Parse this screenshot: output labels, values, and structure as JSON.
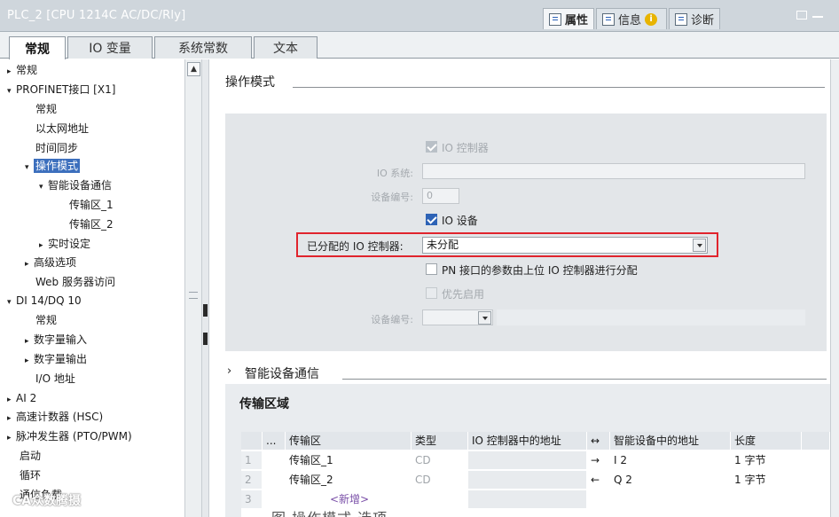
{
  "window": {
    "title": "PLC_2 [CPU 1214C AC/DC/Rly]",
    "tabs": [
      {
        "label": "属性",
        "icon": "properties-icon",
        "active": true
      },
      {
        "label": "信息",
        "icon": "info-icon",
        "active": false
      },
      {
        "label": "诊断",
        "icon": "diagnostics-icon",
        "active": false
      }
    ],
    "info_badge": "i"
  },
  "main_tabs": [
    "常规",
    "IO 变量",
    "系统常数",
    "文本"
  ],
  "tree": [
    {
      "label": "常规",
      "arrow": "▸"
    },
    {
      "label": "PROFINET接口 [X1]",
      "arrow": "▾"
    },
    {
      "label": "常规",
      "arrow": ""
    },
    {
      "label": "以太网地址",
      "arrow": ""
    },
    {
      "label": "时间同步",
      "arrow": ""
    },
    {
      "label": "操作模式",
      "arrow": "▾"
    },
    {
      "label": "智能设备通信",
      "arrow": "▾"
    },
    {
      "label": "传输区_1",
      "arrow": ""
    },
    {
      "label": "传输区_2",
      "arrow": ""
    },
    {
      "label": "实时设定",
      "arrow": "▸"
    },
    {
      "label": "高级选项",
      "arrow": "▸"
    },
    {
      "label": "Web 服务器访问",
      "arrow": ""
    },
    {
      "label": "DI 14/DQ 10",
      "arrow": "▾"
    },
    {
      "label": "常规",
      "arrow": ""
    },
    {
      "label": "数字量输入",
      "arrow": "▸"
    },
    {
      "label": "数字量输出",
      "arrow": "▸"
    },
    {
      "label": "I/O 地址",
      "arrow": ""
    },
    {
      "label": "AI 2",
      "arrow": "▸"
    },
    {
      "label": "高速计数器 (HSC)",
      "arrow": "▸"
    },
    {
      "label": "脉冲发生器 (PTO/PWM)",
      "arrow": "▸"
    },
    {
      "label": "启动",
      "arrow": ""
    },
    {
      "label": "循环",
      "arrow": ""
    },
    {
      "label": "通信负载",
      "arrow": ""
    }
  ],
  "operation_mode": {
    "heading": "操作模式",
    "io_controller_label": "IO 控制器",
    "io_system_label": "IO 系统:",
    "io_system_value": "",
    "device_number_label": "设备编号:",
    "device_number_value": "0",
    "io_device_label": "IO 设备",
    "assigned_controller_label": "已分配的 IO 控制器:",
    "assigned_controller_value": "未分配",
    "pn_param_label": "PN 接口的参数由上位 IO 控制器进行分配",
    "priority_label": "优先启用",
    "device_number2_label": "设备编号:",
    "device_number2_value": ""
  },
  "smart_device": {
    "heading": "智能设备通信",
    "arrow": "›",
    "transfer_title": "传输区域",
    "columns": [
      "...",
      "传输区",
      "类型",
      "IO 控制器中的地址",
      "↔",
      "智能设备中的地址",
      "长度"
    ],
    "rows": [
      {
        "num": "1",
        "name": "传输区_1",
        "type": "CD",
        "ctrl_addr": "",
        "dir": "→",
        "dev_addr": "I 2",
        "length": "1 字节"
      },
      {
        "num": "2",
        "name": "传输区_2",
        "type": "CD",
        "ctrl_addr": "",
        "dir": "←",
        "dev_addr": "Q 2",
        "length": "1 字节"
      },
      {
        "num": "3",
        "name": "<新增>",
        "type": "",
        "ctrl_addr": "",
        "dir": "",
        "dev_addr": "",
        "length": ""
      }
    ]
  },
  "watermark": "CA众数腾摄",
  "caption": "图 操作模式 选项"
}
